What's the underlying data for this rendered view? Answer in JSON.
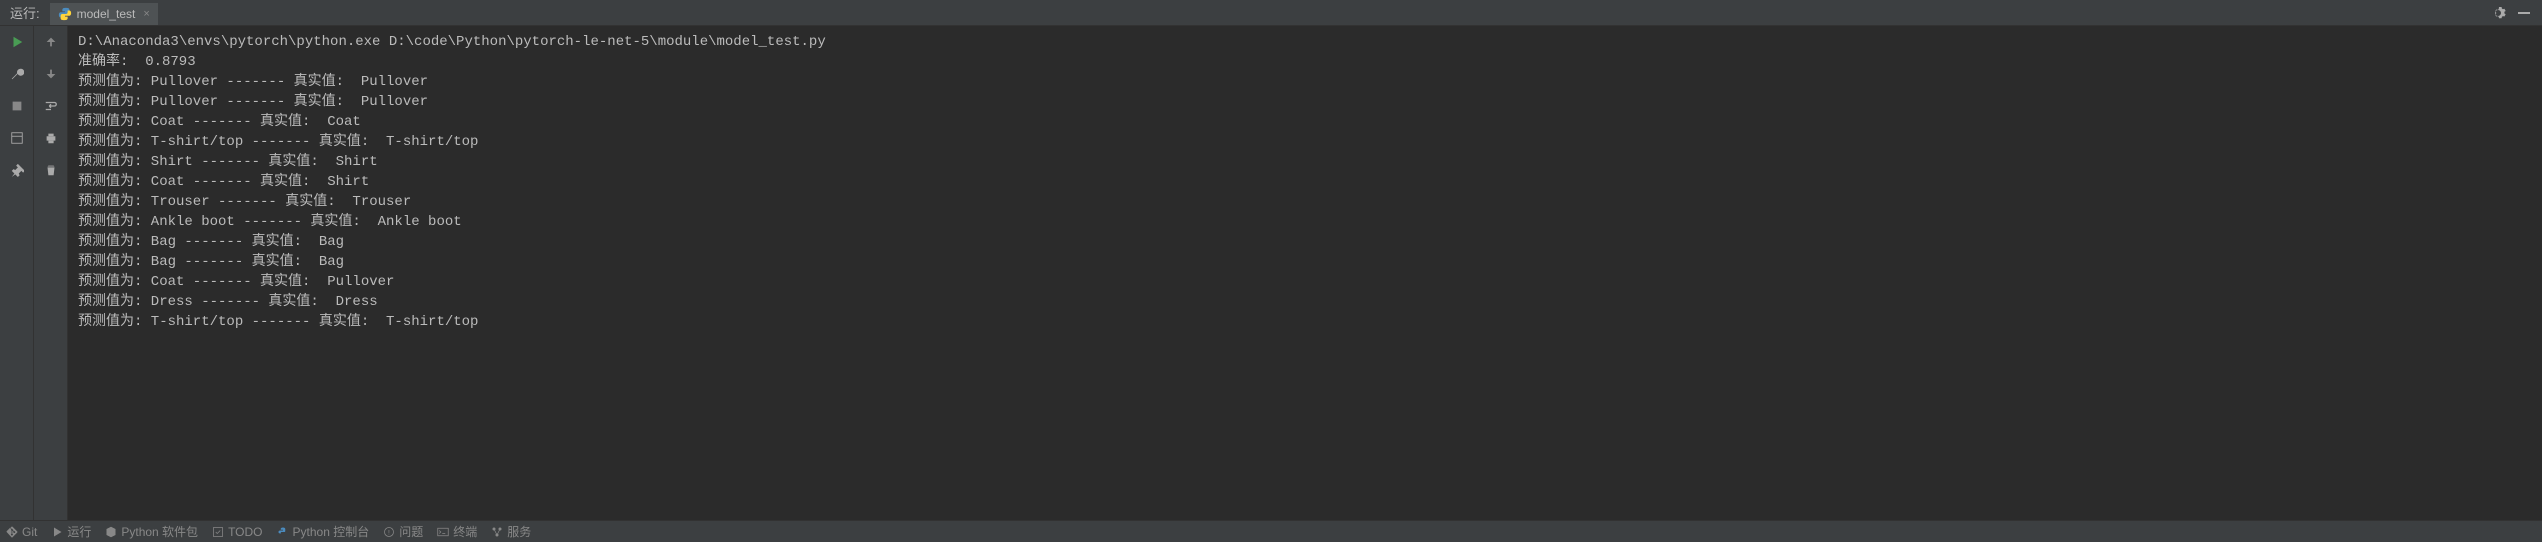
{
  "header": {
    "run_label": "运行:",
    "tab_name": "model_test",
    "tab_close": "×"
  },
  "console": {
    "lines": [
      "D:\\Anaconda3\\envs\\pytorch\\python.exe D:\\code\\Python\\pytorch-le-net-5\\module\\model_test.py",
      "准确率:  0.8793",
      "预测值为: Pullover ------- 真实值:  Pullover",
      "预测值为: Pullover ------- 真实值:  Pullover",
      "预测值为: Coat ------- 真实值:  Coat",
      "预测值为: T-shirt/top ------- 真实值:  T-shirt/top",
      "预测值为: Shirt ------- 真实值:  Shirt",
      "预测值为: Coat ------- 真实值:  Shirt",
      "预测值为: Trouser ------- 真实值:  Trouser",
      "预测值为: Ankle boot ------- 真实值:  Ankle boot",
      "预测值为: Bag ------- 真实值:  Bag",
      "预测值为: Bag ------- 真实值:  Bag",
      "预测值为: Coat ------- 真实值:  Pullover",
      "预测值为: Dress ------- 真实值:  Dress",
      "预测值为: T-shirt/top ------- 真实值:  T-shirt/top"
    ]
  },
  "bottom": {
    "git": "Git",
    "run": "运行",
    "python_packages": "Python 软件包",
    "todo": "TODO",
    "python_console": "Python 控制台",
    "problems": "问题",
    "terminal": "终端",
    "services": "服务"
  }
}
